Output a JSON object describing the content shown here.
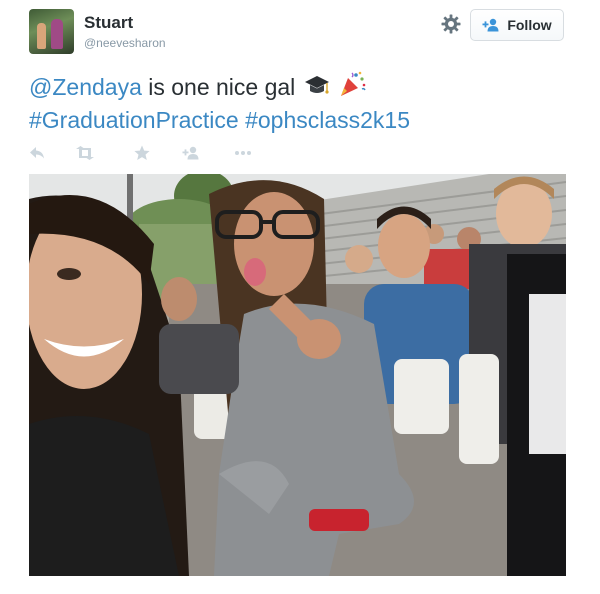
{
  "user": {
    "display_name": "Stuart",
    "handle": "@neevesharon",
    "avatar_icon": "profile-photo"
  },
  "header": {
    "settings_icon": "gear-icon",
    "follow_label": "Follow",
    "follow_icon": "add-user-icon"
  },
  "tweet": {
    "mention": "@Zendaya",
    "text": " is one nice gal",
    "emojis": [
      "graduation-cap-icon",
      "party-popper-icon"
    ],
    "hashtag_1": "#GraduationPractice",
    "hashtag_2": "#ophsclass2k15"
  },
  "actions": [
    "reply-icon",
    "retweet-icon",
    "favorite-icon",
    "follow-icon",
    "more-icon"
  ],
  "media": {
    "description_icon": "tweet-photo"
  },
  "colors": {
    "link": "#3b88c3",
    "text": "#292f33",
    "secondary": "#8899a6",
    "action_icon": "#ccd6dd"
  }
}
